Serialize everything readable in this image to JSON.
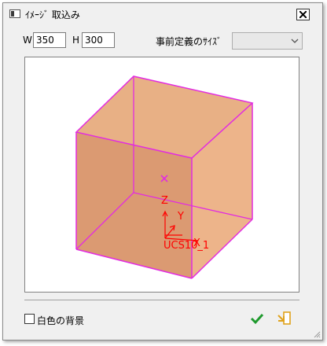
{
  "window": {
    "title": "ｲﾒｰｼﾞ 取込み"
  },
  "size": {
    "w_label": "W",
    "w_value": "350",
    "h_label": "H",
    "h_value": "300",
    "preset_label": "事前定義のｻｲｽﾞ",
    "preset_value": ""
  },
  "preview": {
    "axis_z": "Z",
    "axis_y": "Y",
    "axis_x": "X",
    "ucs_name": "UCS10_1",
    "colors": {
      "cube_fill": "#e8b085",
      "cube_edge": "#e22ce0",
      "axis": "#ff0000",
      "center_mark": "#e22ce0"
    }
  },
  "footer": {
    "white_bg_label": "白色の背景",
    "white_bg_checked": false
  },
  "colors": {
    "ok_check": "#1f9a2e",
    "import_icon": "#e0a21b"
  },
  "icons": [
    "window-app-icon",
    "close-icon",
    "chevron-down-icon",
    "checkmark-icon",
    "import-image-icon",
    "resize-grip-icon"
  ]
}
